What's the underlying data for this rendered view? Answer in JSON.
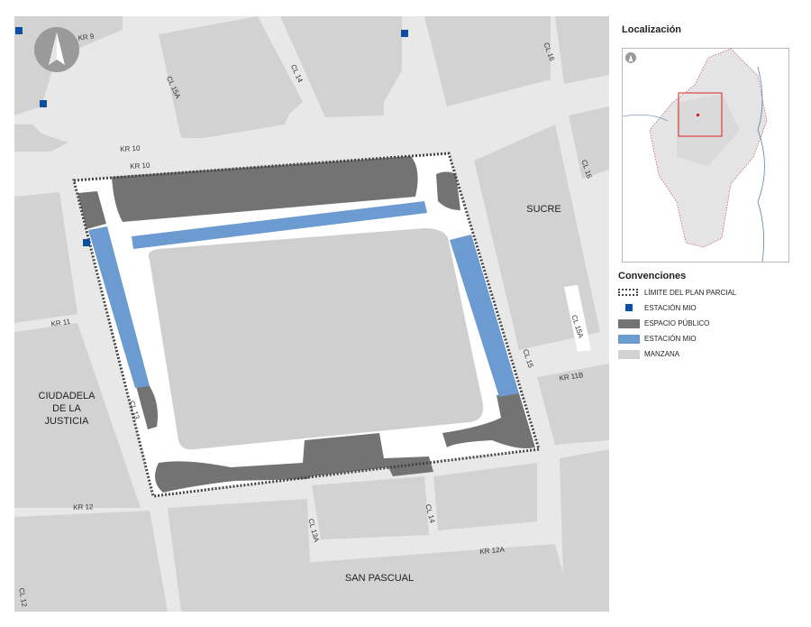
{
  "map": {
    "streets": {
      "kr9": "KR 9",
      "cl15a_top": "CL 15A",
      "cl14_top": "CL 14",
      "cl16_top": "CL 16",
      "kr10_a": "KR 10",
      "kr10_b": "KR 10",
      "cl16_right": "CL 16",
      "kr11": "KR 11",
      "cl13": "CL 13",
      "cl15": "CL 15",
      "cl15a_right": "CL 15A",
      "kr11b": "KR 11B",
      "kr12": "KR 12",
      "cl13a": "CL 13A",
      "cl14_bottom": "CL 14",
      "kr12a": "KR 12A",
      "cl12": "CL 12"
    },
    "areas": {
      "sucre": "SUCRE",
      "ciudadela_l1": "CIUDADELA",
      "ciudadela_l2": "DE LA",
      "ciudadela_l3": "JUSTICIA",
      "san_pascual": "SAN PASCUAL"
    },
    "colors": {
      "street_bg": "#e8e8e8",
      "block": "#d2d2d2",
      "public_space": "#737373",
      "mio_station_area": "#6b9bd1",
      "mio_station_marker": "#0d4fa3",
      "plan_boundary": "#444444"
    },
    "north_arrow": "north-arrow-icon"
  },
  "sidebar": {
    "location_title": "Localización",
    "legend_title": "Convenciones",
    "legend": [
      {
        "label": "LÍMITE DEL PLAN PARCIAL",
        "icon": "dotted-boundary"
      },
      {
        "label": "ESTACIÓN MIO",
        "icon": "blue-square-marker"
      },
      {
        "label": "ESPACIO PÚBLICO",
        "icon": "dark-gray-swatch"
      },
      {
        "label": "ESTACIÓN MIO",
        "icon": "blue-swatch"
      },
      {
        "label": "MANZANA",
        "icon": "light-gray-swatch"
      }
    ]
  }
}
